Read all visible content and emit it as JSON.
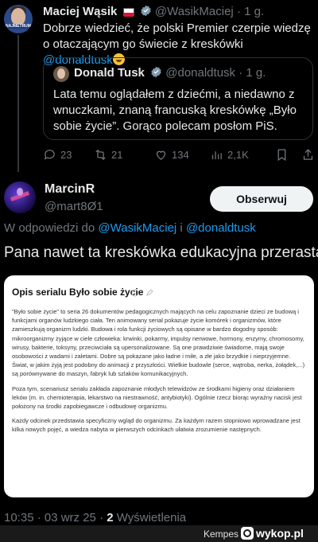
{
  "parent_tweet": {
    "author_name": "Maciej Wąsik",
    "handle": "@WasikMaciej",
    "time": "· 1 g.",
    "avatar_badge": "NAJMETRUM",
    "text_part1": "Dobrze wiedzieć, że polski Premier czerpie wiedzę o otaczającym go świecie z kreskówki ",
    "text_mention": "@donaldtusk",
    "quote": {
      "author_name": "Donald Tusk",
      "handle": "@donaldtusk",
      "time": "· 1 g.",
      "text": "Lata temu oglądałem z dziećmi, a niedawno z wnuczkami, znaną francuską kreskówkę „Było sobie życie”. Gorąco polecam posłom PiS."
    },
    "stats": {
      "replies": "23",
      "reposts": "21",
      "likes": "134",
      "views": "2,1K"
    }
  },
  "reply_tweet": {
    "author_name": "MarcinR",
    "handle": "@mart8Ø1",
    "follow_label": "Obserwuj",
    "reply_prefix": "W odpowiedzi do ",
    "reply_mention1": "@WasikMaciej",
    "reply_and": " i ",
    "reply_mention2": "@donaldtusk",
    "text": "Pana nawet ta kreskówka edukacyjna przerasta.",
    "image": {
      "title": "Opis serialu Było sobie życie",
      "paragraphs": [
        "\"Było sobie życie\" to seria 26 dokumentów pedagogicznych mających na celu zapoznanie dzieci ze budową i funkcjami organów ludzkiego ciała. Ten animowany serial pokazuje życie komórek i organizmów, które zamieszkują organizm ludzki. Budowa i rola funkcji życiowych są opisane w bardzo dogodny sposób: mikroorganizmy żyjące w ciele człowieka: krwinki, pokarmy, impulsy nerwowe, hormony, enzymy, chromosomy, wirusy, bakterie, toksyny, przeciwciała są upersonalizowane. Są one prawdziwie świadome, mają swoje osobowości z wadami i zaletami. Dobre są pokazane jako ładne i miłe, a złe jako brzydkie i nieprzyjemne. Świat, w jakim żyją jest podobny do animacji z przyszłości. Wielkie budowle (serce, wątroba, nerka, żołądek,...) są porównywane do maszyn, fabryk lub szlaków komunikacyjnych.",
        "Poza tym, scenariusz serialu zakłada zapoznanie młodych telewidzów ze środkami higieny oraz działaniem leków (m. in. chemioterapia, lekarstwo na niestrawność, antybiotyki). Ogólnie rzecz biorąc wyraźny nacisk jest położony na środki zapobiegawcze i odbudowę organizmu.",
        "Każdy odcinek przedstawia specyficzny wgląd do organizmu. Za każdym razem stopniowo wprowadzane jest kilka nowych pojęć, a wiedza nabyta w pierwszych odcinkach ułatwia zrozumienie następnych."
      ]
    },
    "timestamp": "10:35 · 03 wrz 25 · ",
    "views_count": "2",
    "views_label": " Wyświetlenia"
  },
  "footer": {
    "username": "Kempes",
    "site_suffix": "z",
    "logo_text": "wykop.pl"
  },
  "colors": {
    "background": "#000000",
    "accent": "#1d9bf0",
    "muted": "#71767b"
  }
}
